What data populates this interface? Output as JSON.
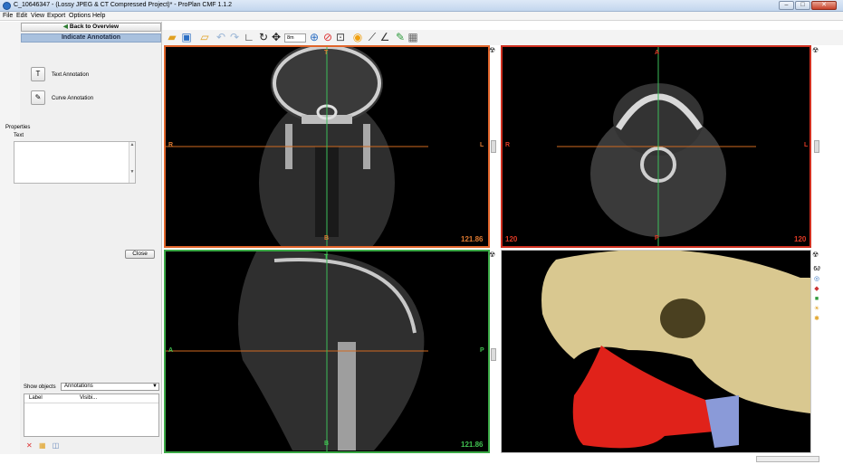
{
  "window": {
    "title": "C_10646347 - (Lossy JPEG & CT Compressed Project)* - ProPlan CMF 1.1.2",
    "minimize": "–",
    "maximize": "□",
    "close": "✕"
  },
  "menu": [
    "File",
    "Edit",
    "View",
    "Export",
    "Options",
    "Help"
  ],
  "left_panel": {
    "back_button": "Back to Overview",
    "header": "Indicate Annotation",
    "tools": [
      {
        "label": "Text Annotation",
        "icon": "text-icon",
        "glyph": "T"
      },
      {
        "label": "Curve Annotation",
        "icon": "curve-icon",
        "glyph": "✎"
      }
    ],
    "properties_label": "Properties",
    "text_label": "Text",
    "text_value": "",
    "close_button": "Close",
    "show_objects_label": "Show objects",
    "show_objects_value": "Annotations",
    "list_columns": [
      "Label",
      "Visibi..."
    ]
  },
  "views": {
    "coronal": {
      "top": "T",
      "bottom": "B",
      "left": "R",
      "right": "L",
      "value": "121.86",
      "frame_color": "#e0652b"
    },
    "axial": {
      "top": "A",
      "bottom": "P",
      "left": "R",
      "right": "L",
      "value_left": "120",
      "value_right": "120",
      "frame_color": "#d03020"
    },
    "sagittal": {
      "top": "T",
      "bottom": "B",
      "left": "A",
      "right": "P",
      "value": "121.86",
      "frame_color": "#3aa845"
    },
    "render3d": {
      "frame_color": "#c8c8c8"
    }
  },
  "toolbar": {
    "zoom_value": "8m"
  },
  "colors": {
    "bone": "#d9c890",
    "mandible_red": "#e0221a",
    "mandible_blue": "#8a9ad8",
    "crosshair_h": "#d06a20",
    "crosshair_v": "#3cbd5a"
  }
}
